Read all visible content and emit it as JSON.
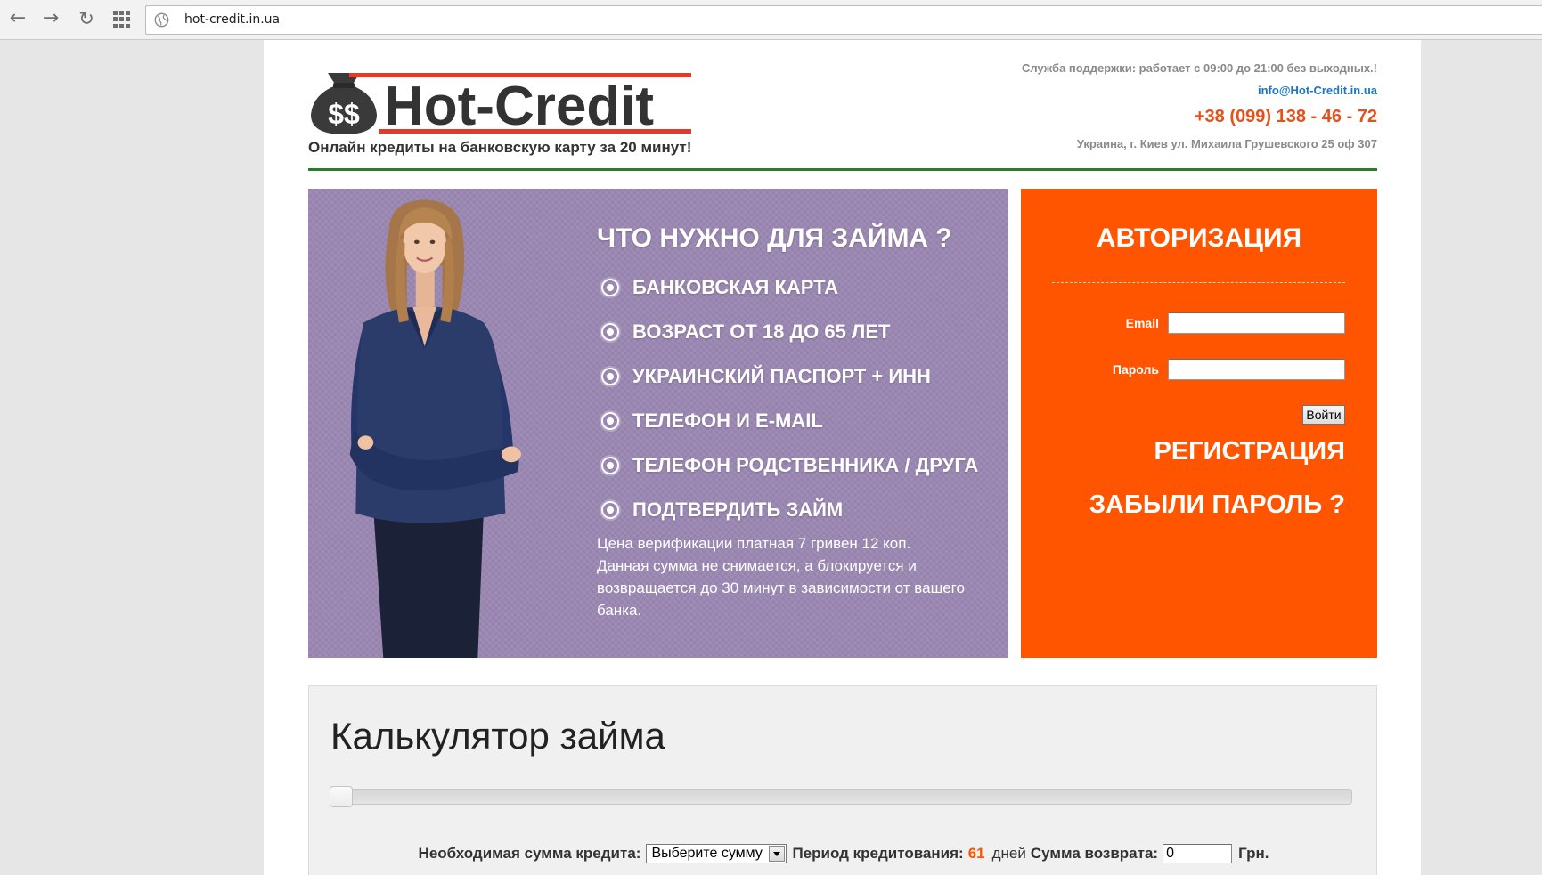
{
  "browser": {
    "url": "hot-credit.in.ua",
    "icons": [
      "back-arrow-icon",
      "forward-arrow-icon",
      "reload-icon",
      "apps-grid-icon",
      "globe-icon"
    ]
  },
  "header": {
    "logo_text": "Hot-Credit",
    "logo_bag_text": "$$",
    "tagline": "Онлайн кредиты на банковскую карту за 20 минут!",
    "support": "Служба поддержки: работает с 09:00 до 21:00 без выходных.!",
    "email": "info@Hot-Credit.in.ua",
    "phone": "+38 (099) 138 - 46 - 72",
    "address": "Украина, г. Киев ул. Михаила Грушевского 25 оф 307"
  },
  "requirements": {
    "title": "ЧТО НУЖНО ДЛЯ ЗАЙМА ?",
    "items": [
      "БАНКОВСКАЯ КАРТА",
      "ВОЗРАСТ ОТ 18 ДО 65 ЛЕТ",
      "УКРАИНСКИЙ ПАСПОРТ + ИНН",
      "ТЕЛЕФОН И E-MAIL",
      "ТЕЛЕФОН РОДСТВЕННИКА / ДРУГА",
      "ПОДТВЕРДИТЬ ЗАЙМ"
    ],
    "note": [
      "Цена верификации платная 7 гривен 12 коп.",
      "Данная сумма не снимается, а блокируется и возвращается до 30 минут в зависимости от вашего банка."
    ]
  },
  "auth": {
    "title": "АВТОРИЗАЦИЯ",
    "email_label": "Email",
    "email_value": "",
    "password_label": "Пароль",
    "password_value": "",
    "login_button": "Войти",
    "register_link": "РЕГИСТРАЦИЯ",
    "forgot_link": "ЗАБЫЛИ ПАРОЛЬ ?"
  },
  "calculator": {
    "title": "Калькулятор займа",
    "amount_slider_fraction": 0,
    "amount_label": "Необходимая сумма кредита:",
    "amount_select": "Выберите сумму",
    "period_label": "Период кредитования:",
    "period_value": "61",
    "days_label": "дней",
    "return_label": "Сумма возврата:",
    "return_value": "0",
    "currency": "Грн."
  },
  "colors": {
    "orange": "#ff5400",
    "purple": "#9a87b2",
    "green": "#2b7d2b",
    "phone": "#e8501a",
    "link": "#1a74c8"
  }
}
